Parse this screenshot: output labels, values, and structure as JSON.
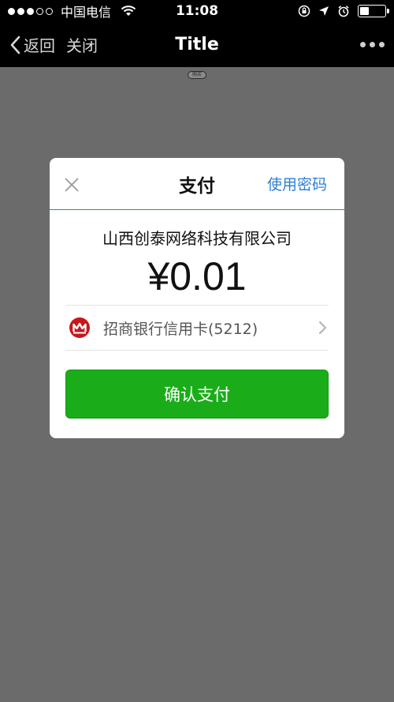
{
  "status_bar": {
    "carrier": "中国电信",
    "time": "11:08"
  },
  "nav": {
    "back_label": "返回",
    "close_label": "关闭",
    "title": "Title"
  },
  "mini_tag": "购买",
  "dialog": {
    "title": "支付",
    "use_password": "使用密码",
    "merchant": "山西创泰网络科技有限公司",
    "amount": "¥0.01",
    "card": "招商银行信用卡(5212)",
    "confirm": "确认支付"
  },
  "colors": {
    "accent_green": "#1aad19",
    "link_blue": "#2f7fd1",
    "overlay": "#6b6b6b",
    "bank_red": "#c8161d"
  }
}
